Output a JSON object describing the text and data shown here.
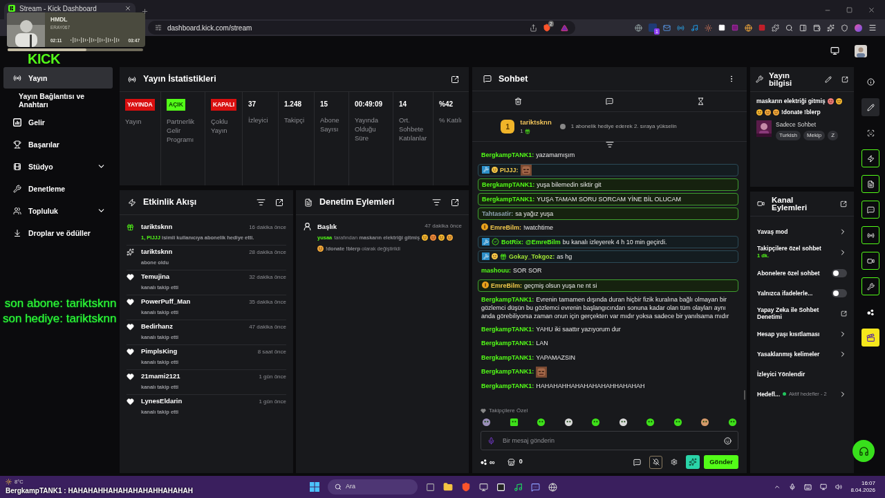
{
  "browser": {
    "tab_title": "Stream - Kick Dashboard",
    "url": "dashboard.kick.com/stream",
    "shield_badge": "2",
    "extension_badge": "1"
  },
  "media_player": {
    "title": "HMDL",
    "artist": "ERAY067",
    "elapsed": "02:11",
    "duration": "03:47",
    "level": 0.58
  },
  "header": {
    "logo": "KICK"
  },
  "sidebar": {
    "items": [
      {
        "label": "Yayın",
        "selected": true,
        "expandable": false
      },
      {
        "label": "Yayın Bağlantısı ve Anahtarı",
        "selected": false,
        "expandable": false
      },
      {
        "label": "Gelir",
        "selected": false,
        "expandable": false
      },
      {
        "label": "Başarılar",
        "selected": false,
        "expandable": false
      },
      {
        "label": "Stüdyo",
        "selected": false,
        "expandable": true
      },
      {
        "label": "Denetleme",
        "selected": false,
        "expandable": false
      },
      {
        "label": "Topluluk",
        "selected": false,
        "expandable": true
      },
      {
        "label": "Droplar ve ödüller",
        "selected": false,
        "expandable": false
      }
    ]
  },
  "stats": {
    "title": "Yayın İstatistikleri",
    "items": [
      {
        "kind": "badge",
        "value": "YAYINDA",
        "color": "#d90f0f",
        "label": "Yayın"
      },
      {
        "kind": "badge",
        "value": "AÇIK",
        "color": "#53fc18",
        "label": "Partnerlik Gelir Programı"
      },
      {
        "kind": "badge",
        "value": "KAPALI",
        "color": "#d90f0f",
        "label": "Çoklu Yayın"
      },
      {
        "kind": "number",
        "value": "37",
        "label": "İzleyici"
      },
      {
        "kind": "number",
        "value": "1.248",
        "label": "Takipçi"
      },
      {
        "kind": "number",
        "value": "15",
        "label": "Abone Sayısı"
      },
      {
        "kind": "number",
        "value": "00:49:09",
        "label": "Yayında Olduğu Süre"
      },
      {
        "kind": "number",
        "value": "14",
        "label": "Ort. Sohbete Katılanlar"
      },
      {
        "kind": "number",
        "value": "%42",
        "label": "% Katılı"
      }
    ]
  },
  "activity": {
    "title": "Etkinlik Akışı",
    "items": [
      {
        "kind": "gift",
        "name": "tariktsknn",
        "time": "16 dakika önce",
        "highlight": "1, PIJJJ",
        "text": "isimli kullanıcıya abonelik hediye etti."
      },
      {
        "kind": "subscribe",
        "name": "tariktsknn",
        "time": "28 dakika önce",
        "text": "abone oldu"
      },
      {
        "kind": "follow",
        "name": "Temujina",
        "time": "32 dakika önce",
        "text": "kanalı takip etti"
      },
      {
        "kind": "follow",
        "name": "PowerPuff_Man",
        "time": "35 dakika önce",
        "text": "kanalı takip etti"
      },
      {
        "kind": "follow",
        "name": "Bedirhanz",
        "time": "47 dakika önce",
        "text": "kanalı takip etti"
      },
      {
        "kind": "follow",
        "name": "PimplsKing",
        "time": "8 saat önce",
        "text": "kanalı takip etti"
      },
      {
        "kind": "follow",
        "name": "21mami2121",
        "time": "1 gün önce",
        "text": "kanalı takip etti"
      },
      {
        "kind": "follow",
        "name": "LynesEldarin",
        "time": "1 gün önce",
        "text": "kanalı takip etti"
      }
    ]
  },
  "moderation": {
    "title": "Denetim Eylemleri",
    "items": [
      {
        "title": "Başlık",
        "time": "47 dakika önce",
        "actor": "yusaa",
        "before": "tarafından **maskarın elektriği gitmiş**",
        "after": "**!donate !blerp** olarak değiştirildi"
      }
    ]
  },
  "chat": {
    "title": "Sohbet",
    "pinned": {
      "user": "tariktsknn",
      "rank": "1",
      "count": "1",
      "promo": "1 abonelik hediye ederek 2. sıraya yükselin"
    },
    "messages": [
      {
        "user": "BergkampTANK1:",
        "color": "#53fc18",
        "text": "yazamamışım",
        "highlighted": false
      },
      {
        "user": "PIJJJ:",
        "color": "#f2c94c",
        "kind": "emote",
        "highlighted": true,
        "badges": [
          {
            "kind": "moderator"
          },
          {
            "kind": "emoji"
          }
        ]
      },
      {
        "user": "BergkampTANK1:",
        "color": "#53fc18",
        "text": "yuşa bilemedin siktir git",
        "highlighted": true
      },
      {
        "user": "BergkampTANK1:",
        "color": "#53fc18",
        "text": "YUŞA TAMAM SORU SORCAM YİNE BİL OLUCAM",
        "highlighted": true
      },
      {
        "user": "Tahtasatir:",
        "color": "#8fa3b3",
        "text": "sa yağız yuşa",
        "highlighted": true
      },
      {
        "user": "EmreBilm:",
        "color": "#f2c94c",
        "text": "!watchtime",
        "highlighted": false,
        "badges": [
          {
            "kind": "subscriber"
          }
        ]
      },
      {
        "user": "BotRix:",
        "color": "#53fc18",
        "mention": "@EmreBilm",
        "text": "bu kanalı izleyerek 4 h 10 min geçirdi.",
        "highlighted": true,
        "badges": [
          {
            "kind": "moderator"
          },
          {
            "kind": "verified"
          }
        ]
      },
      {
        "user": "Gokay_Tokgoz:",
        "color": "#a3e635",
        "text": "as hg",
        "highlighted": true,
        "badges": [
          {
            "kind": "moderator"
          },
          {
            "kind": "emoji"
          },
          {
            "kind": "gifter"
          }
        ]
      },
      {
        "user": "mashouu:",
        "color": "#53fc18",
        "text": "SOR SOR",
        "highlighted": false
      },
      {
        "user": "EmreBilm:",
        "color": "#f2c94c",
        "text": "geçmiş olsun yuşa ne nt si",
        "highlighted": true,
        "badges": [
          {
            "kind": "subscriber"
          }
        ]
      },
      {
        "user": "BergkampTANK1:",
        "color": "#53fc18",
        "text": "Evrenin tamamen dışında duran hiçbir fizik kuralına bağlı olmayan bir gözlemci düşün bu gözlemci evrenin başlangıcından sonuna kadar olan tüm olayları aynı anda görebiliyorsa zaman onun için gerçekten var mıdır yoksa sadece bir yanılsama mıdır",
        "highlighted": false
      },
      {
        "user": "BergkampTANK1:",
        "color": "#53fc18",
        "text": "YAHU iki saattır yazıyorum dur",
        "highlighted": false
      },
      {
        "user": "BergkampTANK1:",
        "color": "#53fc18",
        "text": "LAN",
        "highlighted": false
      },
      {
        "user": "BergkampTANK1:",
        "color": "#53fc18",
        "text": "YAPAMAZSIN",
        "highlighted": false
      },
      {
        "user": "BergkampTANK1:",
        "color": "#53fc18",
        "kind": "emote",
        "highlighted": false
      },
      {
        "user": "BergkampTANK1:",
        "color": "#53fc18",
        "text": "HAHAHAHHAHAHAHAHAHHAHAHAH",
        "highlighted": false
      }
    ],
    "emote_section": "Takipçilere Özel",
    "placeholder": "Bir mesaj gönderin",
    "infinity": "∞",
    "store_count": "0",
    "send": "Gönder"
  },
  "stream_info": {
    "title": "Yayın bilgisi",
    "stream_title_start": "maskarın elektriği gitmiş",
    "stream_title_end": "!donate !blerp",
    "category": "Sadece Sohbet",
    "tags": [
      "Turkish",
      "Mekip",
      "Z"
    ]
  },
  "channel_actions": {
    "title": "Kanal Eylemleri",
    "items": [
      {
        "kind": "link",
        "label": "Yavaş mod"
      },
      {
        "kind": "link",
        "label": "Takipçilere özel sohbet",
        "value": "1 dk."
      },
      {
        "kind": "toggle",
        "label": "Abonelere özel sohbet",
        "on": false
      },
      {
        "kind": "toggle",
        "label": "Yalnızca ifadelerle...",
        "on": false
      },
      {
        "kind": "external",
        "label": "Yapay Zeka ile Sohbet Denetimi"
      },
      {
        "kind": "link",
        "label": "Hesap yaşı kısıtlaması"
      },
      {
        "kind": "link",
        "label": "Yasaklanmış kelimeler"
      },
      {
        "kind": "plain",
        "label": "İzleyici Yönlendir"
      },
      {
        "kind": "link",
        "label": "Hedefl...",
        "status": "Aktif hedefler - 2",
        "color": "#22c55e"
      }
    ]
  },
  "rail": [
    {
      "kind": "info",
      "selected": false,
      "active": false
    },
    {
      "kind": "edit",
      "selected": true,
      "active": false
    },
    {
      "kind": "capture",
      "selected": false,
      "active": false
    },
    {
      "kind": "zap",
      "selected": false,
      "active": true
    },
    {
      "kind": "doc",
      "selected": false,
      "active": true
    },
    {
      "kind": "chat",
      "selected": false,
      "active": true
    },
    {
      "kind": "broadcast",
      "selected": false,
      "active": true
    },
    {
      "kind": "camera",
      "selected": false,
      "active": true
    },
    {
      "kind": "wrench",
      "selected": false,
      "active": true
    },
    {
      "kind": "dots",
      "selected": false,
      "active": false
    },
    {
      "kind": "clapper",
      "selected": false,
      "active": false
    }
  ],
  "stream_overlay": {
    "lines": [
      "son abone: tariktsknn",
      "son hediye: tariktsknn"
    ],
    "ticker": "BergkampTANK1 : HAHAHAHHAHAHAHAHAHHAHAHAH"
  },
  "taskbar": {
    "weather": "8°C",
    "search": "Ara",
    "time": "16:07",
    "date": "8.04.2026"
  }
}
